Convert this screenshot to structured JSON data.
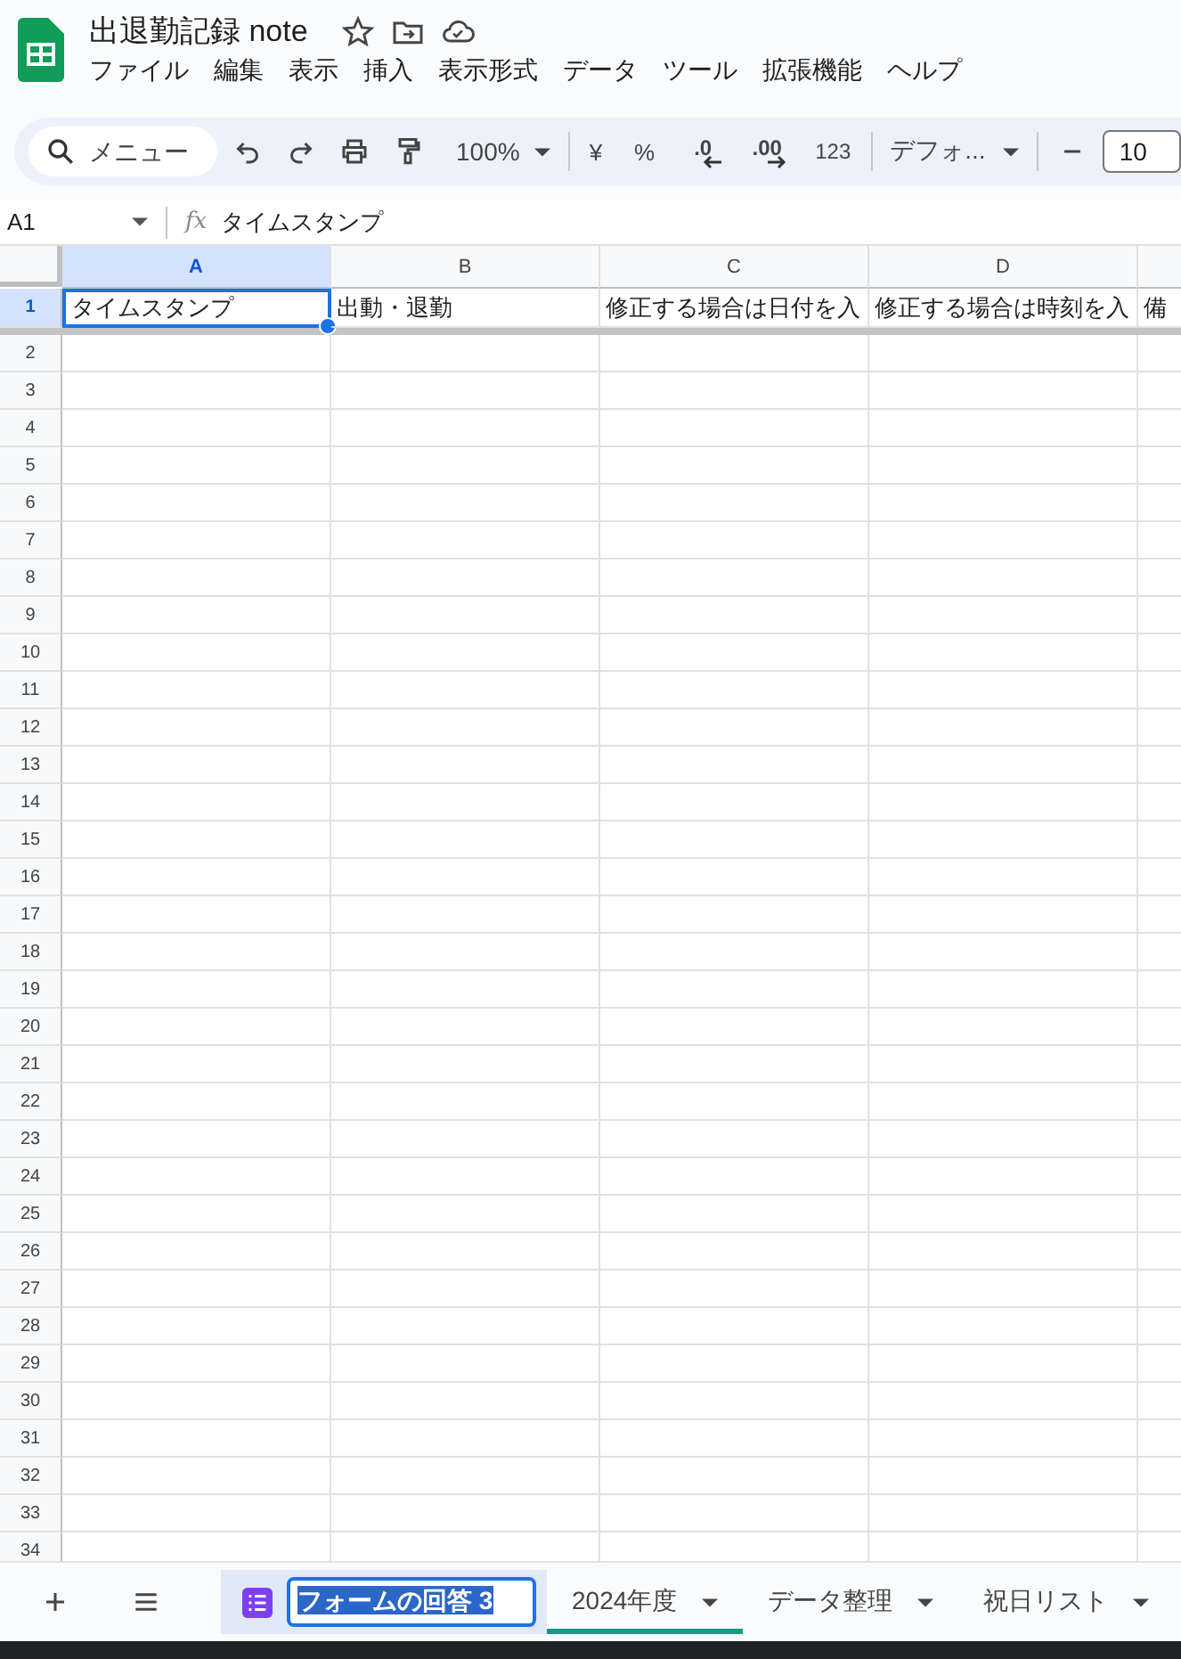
{
  "document": {
    "title": "出退勤記録 note"
  },
  "menu": [
    "ファイル",
    "編集",
    "表示",
    "挿入",
    "表示形式",
    "データ",
    "ツール",
    "拡張機能",
    "ヘルプ"
  ],
  "toolbar": {
    "search_placeholder": "メニュー",
    "zoom": "100%",
    "currency": "¥",
    "percent": "%",
    "decimal_decrease": ".0",
    "decimal_increase": ".00",
    "number_format": "123",
    "font": "デフォ...",
    "font_size": "10"
  },
  "formula_bar": {
    "cell_ref": "A1",
    "fx": "fx",
    "value": "タイムスタンプ"
  },
  "columns": [
    {
      "label": "A",
      "selected": true
    },
    {
      "label": "B",
      "selected": false
    },
    {
      "label": "C",
      "selected": false
    },
    {
      "label": "D",
      "selected": false
    },
    {
      "selected": false
    }
  ],
  "rows": [
    {
      "number": "1",
      "selected": true,
      "cells": [
        {
          "text": "タイムスタンプ",
          "selected": true
        },
        {
          "text": "出動・退勤",
          "selected": false
        },
        {
          "text": "修正する場合は日付を入",
          "selected": false
        },
        {
          "text": "修正する場合は時刻を入",
          "selected": false
        },
        {
          "text": "備",
          "selected": false
        }
      ]
    },
    {
      "number": "2",
      "selected": false
    },
    {
      "number": "3",
      "selected": false
    },
    {
      "number": "4",
      "selected": false
    },
    {
      "number": "5",
      "selected": false
    },
    {
      "number": "6",
      "selected": false
    },
    {
      "number": "7",
      "selected": false
    },
    {
      "number": "8",
      "selected": false
    },
    {
      "number": "9",
      "selected": false
    },
    {
      "number": "10",
      "selected": false
    },
    {
      "number": "11",
      "selected": false
    },
    {
      "number": "12",
      "selected": false
    },
    {
      "number": "13",
      "selected": false
    },
    {
      "number": "14",
      "selected": false
    },
    {
      "number": "15",
      "selected": false
    },
    {
      "number": "16",
      "selected": false
    },
    {
      "number": "17",
      "selected": false
    },
    {
      "number": "18",
      "selected": false
    },
    {
      "number": "19",
      "selected": false
    },
    {
      "number": "20",
      "selected": false
    },
    {
      "number": "21",
      "selected": false
    },
    {
      "number": "22",
      "selected": false
    },
    {
      "number": "23",
      "selected": false
    },
    {
      "number": "24",
      "selected": false
    },
    {
      "number": "25",
      "selected": false
    },
    {
      "number": "26",
      "selected": false
    },
    {
      "number": "27",
      "selected": false
    },
    {
      "number": "28",
      "selected": false
    },
    {
      "number": "29",
      "selected": false
    },
    {
      "number": "30",
      "selected": false
    },
    {
      "number": "31",
      "selected": false
    },
    {
      "number": "32",
      "selected": false
    },
    {
      "number": "33",
      "selected": false
    },
    {
      "number": "34",
      "selected": false
    }
  ],
  "sheet_tabs": [
    {
      "label": "フォームの回答 3",
      "selected": true,
      "kind": "form"
    },
    {
      "label": "2024年度",
      "selected": false,
      "kind": "sheet",
      "color": "#139c8a"
    },
    {
      "label": "データ整理",
      "selected": false,
      "kind": "sheet"
    },
    {
      "label": "祝日リスト",
      "selected": false,
      "kind": "sheet"
    }
  ]
}
